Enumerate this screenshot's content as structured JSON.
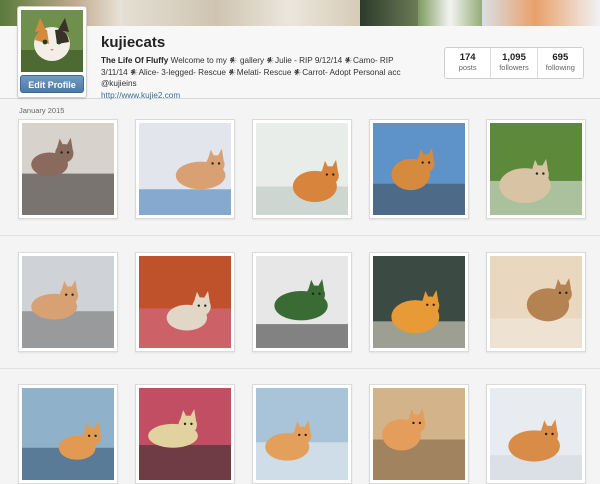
{
  "profile": {
    "username": "kujiecats",
    "edit_label": "Edit Profile",
    "bio_title": "The Life Of Fluffy",
    "bio_text": "Welcome to my 𒀭 gallery 𒀭Julie - RIP 9/12/14 𒀭Camo- RIP 3/11/14 𒀭Alice- 3-legged- Rescue 𒀭Melati- Rescue 𒀭Carrot- Adopt Personal acc @kujieins",
    "website": "http://www.kujie2.com"
  },
  "stats": [
    {
      "value": "174",
      "label": "posts"
    },
    {
      "value": "1,095",
      "label": "followers"
    },
    {
      "value": "695",
      "label": "following"
    }
  ],
  "feed": {
    "month_label": "January 2015"
  },
  "photos": [
    {
      "name": "photo-tricolor-kittens-on-blanket",
      "palette": [
        "#d8d2cc",
        "#8a6a5c",
        "#2b2623"
      ]
    },
    {
      "name": "photo-calico-with-cone",
      "palette": [
        "#e2e6ec",
        "#d9a173",
        "#3a78b8"
      ]
    },
    {
      "name": "photo-orange-kitten-on-tiles",
      "palette": [
        "#e9ede9",
        "#d9843c",
        "#b8c2bd"
      ]
    },
    {
      "name": "photo-orange-kitten-on-car",
      "palette": [
        "#5d93c9",
        "#d68a3e",
        "#3f4a52"
      ]
    },
    {
      "name": "photo-cats-on-grass",
      "palette": [
        "#5c8a3a",
        "#d8c3a4",
        "#ededed"
      ]
    },
    {
      "name": "photo-cat-lying-on-counter",
      "palette": [
        "#cfd3d8",
        "#d8a174",
        "#6c6c6c"
      ]
    },
    {
      "name": "photo-kittens-with-flowers-collage",
      "palette": [
        "#c0522b",
        "#e2d6c6",
        "#d66d9a"
      ]
    },
    {
      "name": "photo-white-cat-on-desk",
      "palette": [
        "#e7e7e7",
        "#3b6b35",
        "#2f2f2f"
      ]
    },
    {
      "name": "photo-koi-and-ginger-cat",
      "palette": [
        "#3b4a43",
        "#e79a35",
        "#efe6d6"
      ]
    },
    {
      "name": "photo-cat-stretching-on-sheets",
      "palette": [
        "#e9d8bf",
        "#b58351",
        "#f2ece4"
      ]
    },
    {
      "name": "photo-orange-kitten-on-cushion",
      "palette": [
        "#8fb1c9",
        "#e29a52",
        "#2d4f6e"
      ]
    },
    {
      "name": "photo-kittens-eating-from-bowl",
      "palette": [
        "#c24e63",
        "#e2d2a0",
        "#2b2b2b"
      ]
    },
    {
      "name": "photo-orange-kitten-sleeping",
      "palette": [
        "#a9c3d8",
        "#e3a05c",
        "#eef2f5"
      ]
    },
    {
      "name": "photo-tabby-kitten-standing",
      "palette": [
        "#d2b38a",
        "#e59d5c",
        "#7a5b3d"
      ]
    },
    {
      "name": "photo-kitten-on-back",
      "palette": [
        "#e8ecf0",
        "#d98c47",
        "#cfd7de"
      ]
    }
  ]
}
